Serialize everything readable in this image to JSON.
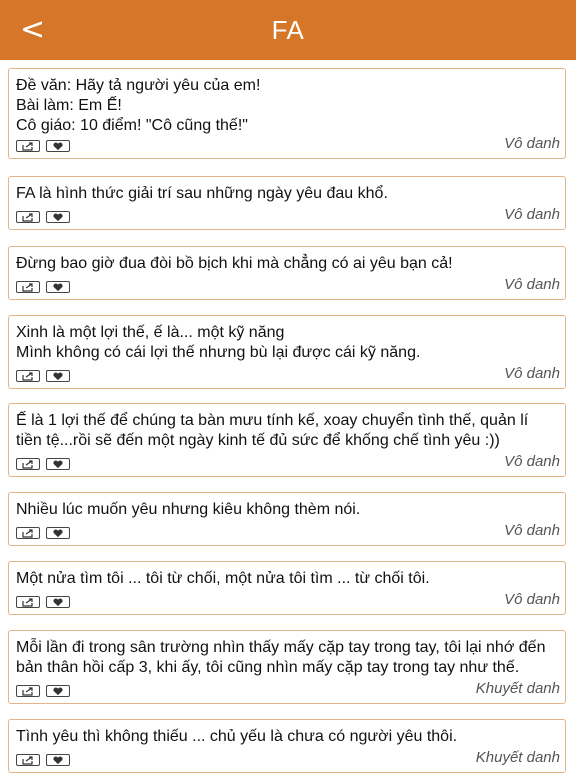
{
  "header": {
    "back_label": "<",
    "title": "FA"
  },
  "posts": [
    {
      "text": "Đề văn: Hãy tả người yêu của em!\nBài làm: Em Ế!\nCô giáo: 10 điểm! \"Cô cũng thế!\"",
      "author": "Vô danh"
    },
    {
      "text": "FA là hình thức giải trí sau những ngày yêu đau khổ.",
      "author": "Vô danh"
    },
    {
      "text": "Đừng bao giờ đua đòi bồ bịch khi mà chẳng có ai yêu bạn cả!",
      "author": "Vô danh"
    },
    {
      "text": "Xinh là một lợi thế, ế là... một kỹ năng\nMình không có cái lợi thế nhưng bù lại được cái kỹ năng.",
      "author": "Vô danh"
    },
    {
      "text": "Ế là 1 lợi thế để chúng ta bàn mưu tính kế, xoay chuyển tình thế, quản lí tiền tệ...rồi sẽ đến một ngày kinh tế đủ sức để khống chế tình yêu :))",
      "author": "Vô danh"
    },
    {
      "text": "Nhiều lúc muốn yêu nhưng kiêu không thèm nói.",
      "author": "Vô danh"
    },
    {
      "text": "Một nửa tìm tôi ... tôi từ chối, một nửa tôi tìm ... từ chối tôi.",
      "author": "Vô danh"
    },
    {
      "text": "Mỗi lần đi trong sân trường nhìn thấy mấy cặp tay trong tay, tôi lại nhớ đến bản thân hồi cấp 3, khi ấy, tôi cũng nhìn mấy cặp tay trong tay như thế.",
      "author": "Khuyết danh"
    },
    {
      "text": "Tình yêu thì không thiếu ... chủ yếu là chưa có người yêu thôi.",
      "author": "Khuyết danh"
    }
  ],
  "icons": {
    "share": "share-icon",
    "like": "heart-icon"
  },
  "colors": {
    "header_bg": "#d67628",
    "card_border": "#e4b48a"
  }
}
